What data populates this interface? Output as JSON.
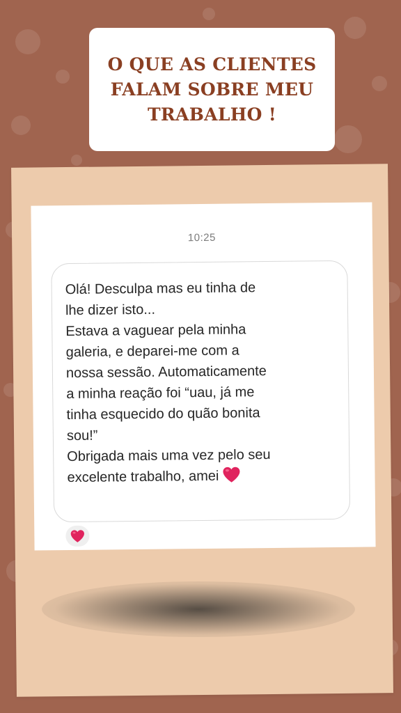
{
  "title": {
    "text": "O QUE AS CLIENTES\nFALAM SOBRE MEU\nTRABALHO !"
  },
  "chat": {
    "time": "10:25",
    "message_lines": [
      "Olá! Desculpa mas eu tinha de",
      "lhe dizer isto...",
      "Estava a vaguear pela minha",
      "galeria, e deparei-me com a",
      "nossa sessão. Automaticamente",
      "a minha reação foi “uau, já me",
      "tinha esquecido do quão bonita",
      "sou!”",
      "Obrigada mais uma vez pelo seu",
      "excelente trabalho, amei"
    ],
    "inline_emoji": "heart-icon",
    "reaction_emoji": "heart-icon"
  },
  "colors": {
    "background": "#a0644f",
    "title_text": "#8a3f22",
    "paper": "#edcbac",
    "heart": "#e0245e"
  }
}
